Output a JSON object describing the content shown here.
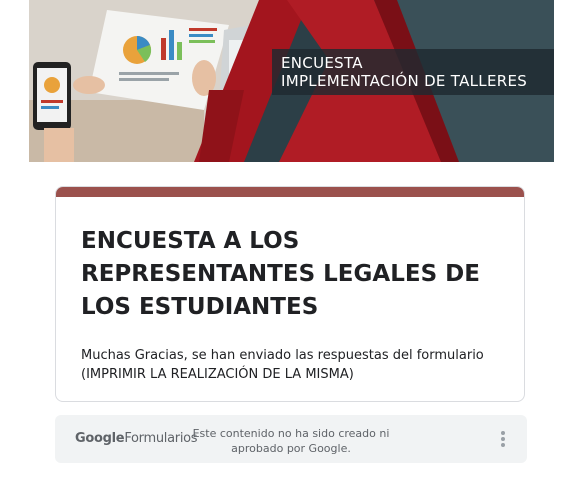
{
  "banner": {
    "line1": "ENCUESTA",
    "line2": "IMPLEMENTACIÓN DE TALLERES"
  },
  "form": {
    "title": "ENCUESTA A LOS REPRESENTANTES LEGALES DE LOS ESTUDIANTES",
    "confirmation_line1": "Muchas Gracias, se han enviado las respuestas del formulario",
    "confirmation_line2": "(IMPRIMIR LA REALIZACIÓN DE LA MISMA)",
    "accent_color": "#9b514d"
  },
  "footer": {
    "brand_google": "Google",
    "brand_product": "Formularios",
    "disclaimer": "Este contenido no ha sido creado ni aprobado por Google.",
    "menu_icon": "more-vert-icon"
  }
}
